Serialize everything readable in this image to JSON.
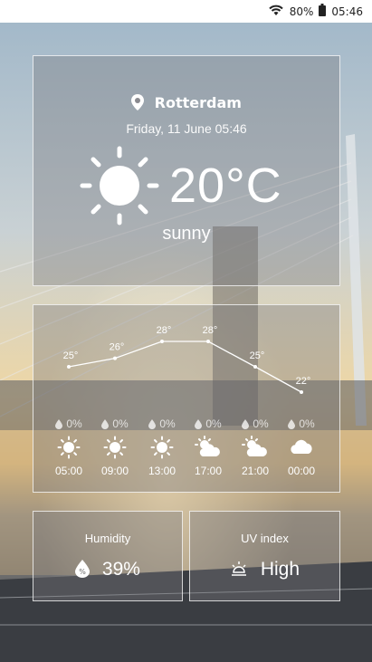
{
  "status": {
    "battery": "80%",
    "time": "05:46"
  },
  "location": {
    "city": "Rotterdam",
    "date": "Friday, 11 June 05:46"
  },
  "current": {
    "temperature": "20°C",
    "condition": "sunny"
  },
  "chart_data": {
    "type": "line",
    "x": [
      "05:00",
      "09:00",
      "13:00",
      "17:00",
      "21:00",
      "00:00"
    ],
    "values": [
      25,
      26,
      28,
      28,
      25,
      22
    ],
    "labels": [
      "25°",
      "26°",
      "28°",
      "28°",
      "25°",
      "22°"
    ]
  },
  "hourly": [
    {
      "time": "05:00",
      "precip": "0%",
      "icon": "sun-icon"
    },
    {
      "time": "09:00",
      "precip": "0%",
      "icon": "sun-icon"
    },
    {
      "time": "13:00",
      "precip": "0%",
      "icon": "sun-icon"
    },
    {
      "time": "17:00",
      "precip": "0%",
      "icon": "partly-cloudy-icon"
    },
    {
      "time": "21:00",
      "precip": "0%",
      "icon": "partly-cloudy-icon"
    },
    {
      "time": "00:00",
      "precip": "0%",
      "icon": "cloud-icon"
    }
  ],
  "humidity": {
    "title": "Humidity",
    "value": "39%"
  },
  "uv": {
    "title": "UV index",
    "value": "High"
  }
}
